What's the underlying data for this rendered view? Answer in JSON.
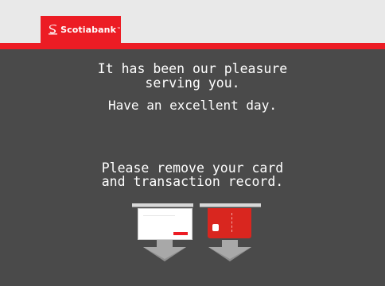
{
  "brand": {
    "name": "Scotiabank",
    "trademark": "™",
    "colors": {
      "red": "#ec1c24",
      "background": "#4a4a4a",
      "header": "#e9e9e9",
      "text": "#ffffff"
    }
  },
  "messages": {
    "thanks": "It has been our pleasure\nserving you.",
    "farewell": "Have an excellent day.",
    "remove": "Please remove your card\nand transaction record."
  },
  "illustrations": {
    "receipt": "transaction-record",
    "card": "bank-card",
    "arrows": "down-arrow-icon"
  }
}
